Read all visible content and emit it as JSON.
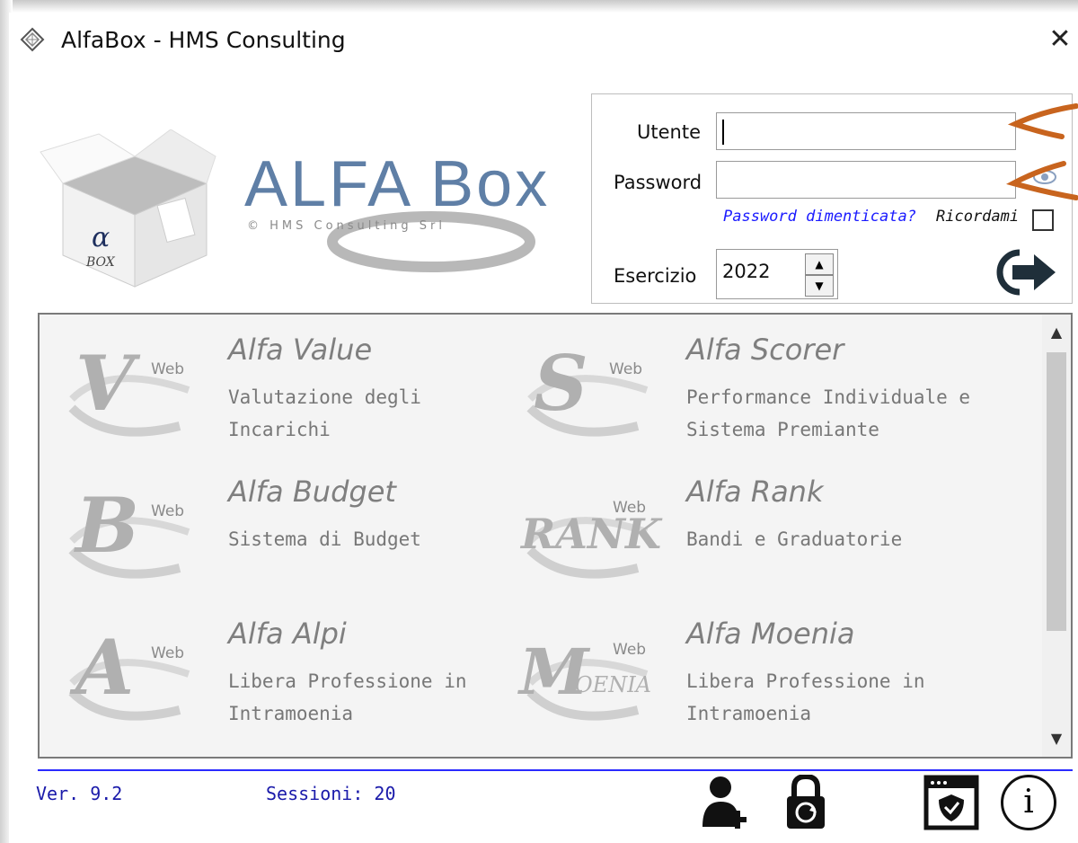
{
  "window": {
    "title": "AlfaBox - HMS Consulting",
    "close_glyph": "✕"
  },
  "logo": {
    "text": "ALFA Box",
    "subtitle": "© HMS Consulting Srl",
    "box_label": "α BOX"
  },
  "login": {
    "user_label": "Utente",
    "user_value": "",
    "password_label": "Password",
    "password_value": "",
    "forgot_label": "Password dimenticata?",
    "remember_label": "Ricordami",
    "remember_checked": false,
    "year_label": "Esercizio",
    "year_value": "2022",
    "show_password_icon": "eye-icon",
    "login_icon": "login-arrow-icon"
  },
  "apps": [
    {
      "name": "Alfa Value",
      "desc": "Valutazione degli Incarichi",
      "badge": "V",
      "web": "Web"
    },
    {
      "name": "Alfa Scorer",
      "desc": "Performance Individuale e Sistema Premiante",
      "badge": "S",
      "web": "Web"
    },
    {
      "name": "Alfa Budget",
      "desc": "Sistema di Budget",
      "badge": "B",
      "web": "Web"
    },
    {
      "name": "Alfa Rank",
      "desc": "Bandi e Graduatorie",
      "badge": "RANK",
      "web": "Web"
    },
    {
      "name": "Alfa Alpi",
      "desc": "Libera Professione in Intramoenia",
      "badge": "A",
      "web": "Web"
    },
    {
      "name": "Alfa Moenia",
      "desc": "Libera Professione in Intramoenia",
      "badge": "MOENIA",
      "web": "Web"
    }
  ],
  "footer": {
    "version": "Ver. 9.2",
    "sessions": "Sessioni: 20",
    "icons": [
      "add-user-icon",
      "lock-refresh-icon",
      "security-window-icon",
      "info-icon"
    ],
    "info_glyph": "i"
  },
  "colors": {
    "accent_blue": "#2a2aff",
    "annotation_orange": "#c8641e",
    "logo_blue": "#5f7fa6"
  }
}
